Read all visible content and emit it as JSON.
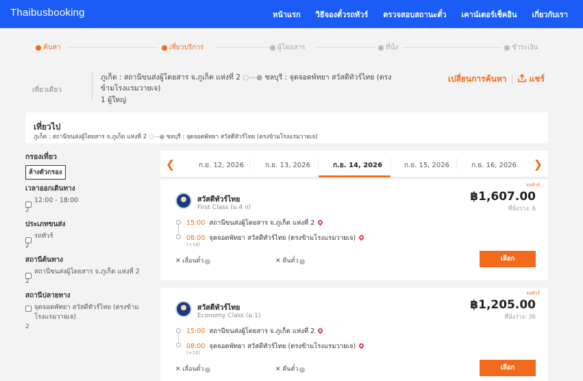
{
  "navbar": {
    "brand": "Thaibusbooking",
    "links": [
      "หน้าแรก",
      "วิธีจองตั๋วรถทัวร์",
      "ตรวจสอบสถานะตั๋ว",
      "เคาน์เตอร์เช็คอิน",
      "เกี่ยวกับเรา"
    ]
  },
  "steps": [
    {
      "label": "ค้นหา",
      "state": "active"
    },
    {
      "label": "เที่ยวบริการ",
      "state": "active"
    },
    {
      "label": "ผู้โดยสาร",
      "state": "inactive"
    },
    {
      "label": "ที่นั่ง",
      "state": "inactive"
    },
    {
      "label": "ชำระเงิน",
      "state": "inactive"
    }
  ],
  "summary": {
    "trip_type": "เที่ยวเดียว",
    "origin": "ภูเก็ต : สถานีขนส่งผู้โดยสาร จ.ภูเก็ต แห่งที่ 2",
    "destination": "ชลบุรี : จุดจอดพัทยา สวัสดีทัวร์ไทย (ตรงข้ามโรงแรมวายเจ)",
    "passengers": "1 ผู้ใหญ่",
    "change_search": "เปลี่ยนการค้นหา",
    "share": "แชร์"
  },
  "outbound": {
    "title": "เที่ยวไป",
    "origin": "ภูเก็ต : สถานีขนส่งผู้โดยสาร จ.ภูเก็ต แห่งที่ 2",
    "destination": "ชลบุรี : จุดจอดพัทยา สวัสดีทัวร์ไทย (ตรงข้ามโรงแรมวายเจ)"
  },
  "filters": {
    "title": "กรองเที่ยว",
    "clear": "ล้างตัวกรอง",
    "sections": [
      {
        "title": "เวลาออกเดินทาง",
        "option": "12:00 - 18:00",
        "count": "2"
      },
      {
        "title": "ประเภทขนส่ง",
        "option": "รถทัวร์",
        "count": "2"
      },
      {
        "title": "สถานีต้นทาง",
        "option": "สถานีขนส่งผู้โดยสาร จ.ภูเก็ต แห่งที่ 2",
        "count": "2"
      },
      {
        "title": "สถานีปลายทาง",
        "option": "จุดจอดพัทยา สวัสดีทัวร์ไทย (ตรงข้ามโรงแรมวายเจ)",
        "count": "2"
      }
    ]
  },
  "dates": [
    "ก.ย. 12, 2026",
    "ก.ย. 13, 2026",
    "ก.ย. 14, 2026",
    "ก.ย. 15, 2026",
    "ก.ย. 16, 2026"
  ],
  "selected_date_index": 2,
  "trips": [
    {
      "tag": "รถทัวร์",
      "operator": "สวัสดีทัวร์ไทย",
      "class": "First Class (ม.4 ก)",
      "price": "฿1,607.00",
      "seats": "ที่นั่งว่าง: 6",
      "depart_time": "15:00",
      "depart_station": "สถานีขนส่งผู้โดยสาร จ.ภูเก็ต แห่งที่ 2",
      "arrive_time": "08:00",
      "arrive_station": "จุดจอดพัทยา สวัสดีทัวร์ไทย (ตรงข้ามโรงแรมวายเจ)",
      "next_day": "(+1d)",
      "reschedule": "เลื่อนตั๋ว",
      "refund": "คืนตั๋ว",
      "select": "เลือก"
    },
    {
      "tag": "รถทัวร์",
      "operator": "สวัสดีทัวร์ไทย",
      "class": "Economy Class (ม.1)",
      "price": "฿1,205.00",
      "seats": "ที่นั่งว่าง: 36",
      "depart_time": "15:00",
      "depart_station": "สถานีขนส่งผู้โดยสาร จ.ภูเก็ต แห่งที่ 2",
      "arrive_time": "08:00",
      "arrive_station": "จุดจอดพัทยา สวัสดีทัวร์ไทย (ตรงข้ามโรงแรมวายเจ)",
      "next_day": "(+1d)",
      "reschedule": "เลื่อนตั๋ว",
      "refund": "คืนตั๋ว",
      "select": "เลือก"
    }
  ],
  "colors": {
    "primary": "#1a5cf5",
    "accent": "#f26a1b",
    "pin": "#e8334a"
  }
}
